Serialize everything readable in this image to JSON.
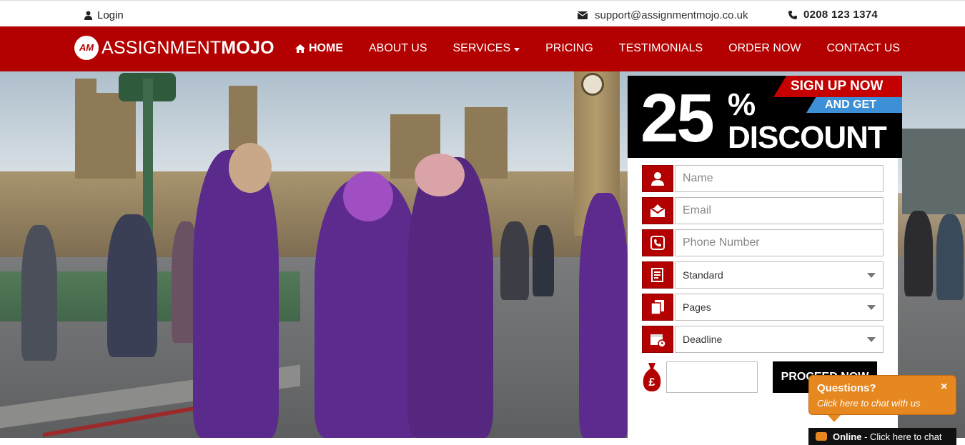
{
  "topbar": {
    "login_label": "Login",
    "email": "support@assignmentmojo.co.uk",
    "phone": "0208 123 1374"
  },
  "brand": {
    "logo_mark": "AM",
    "name_regular": "ASSIGNMENT",
    "name_bold": "MOJO",
    "red": "#b30000"
  },
  "nav": {
    "items": [
      {
        "label": "HOME"
      },
      {
        "label": "ABOUT US"
      },
      {
        "label": "SERVICES"
      },
      {
        "label": "PRICING"
      },
      {
        "label": "TESTIMONIALS"
      },
      {
        "label": "ORDER NOW"
      },
      {
        "label": "CONTACT US"
      }
    ]
  },
  "promo": {
    "ribbon_top": "SIGN UP NOW",
    "ribbon_sub": "AND GET",
    "percent": "25",
    "percent_sign": "%",
    "discount": "DISCOUNT"
  },
  "form": {
    "name_placeholder": "Name",
    "email_placeholder": "Email",
    "phone_placeholder": "Phone Number",
    "service_value": "Standard",
    "pages_value": "Pages",
    "deadline_value": "Deadline",
    "price_value": "",
    "proceed_label": "PROCEED NOW"
  },
  "chat": {
    "question": "Questions?",
    "subtitle": "Click here to chat with us",
    "close": "×",
    "status": "Online",
    "status_text": " - Click here to chat"
  }
}
